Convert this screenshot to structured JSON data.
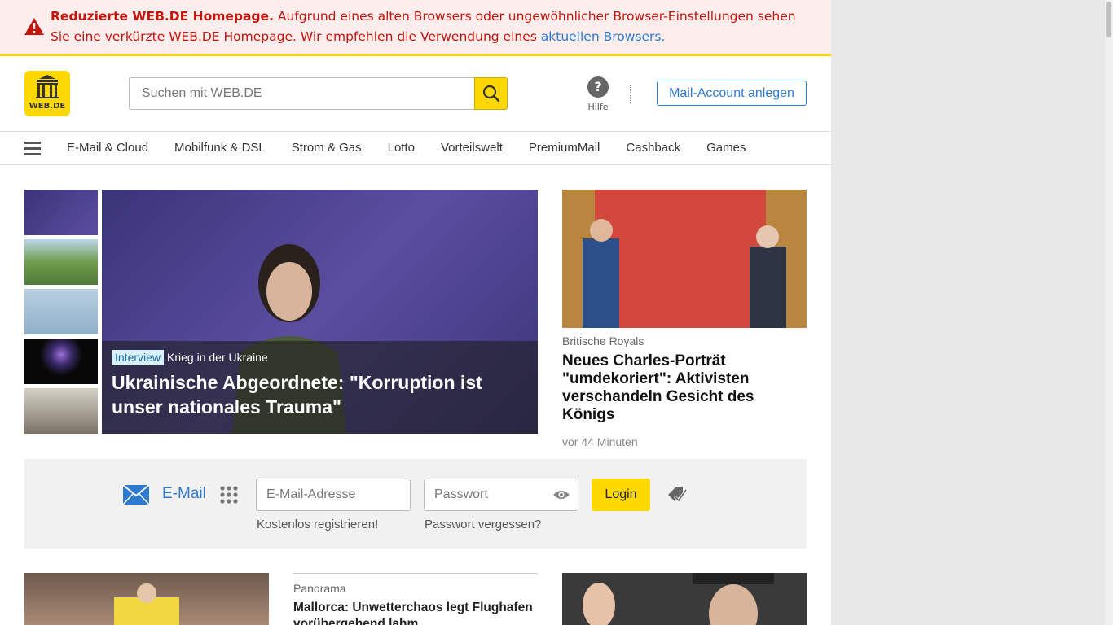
{
  "warning": {
    "bold": "Reduzierte WEB.DE Homepage.",
    "text": " Aufgrund eines alten Browsers oder ungewöhnlicher Browser-Einstellungen sehen Sie eine verkürzte WEB.DE Homepage. Wir empfehlen die Verwendung eines ",
    "link": "aktuellen Browsers."
  },
  "header": {
    "logo_text": "WEB.DE",
    "search_placeholder": "Suchen mit WEB.DE",
    "help_label": "Hilfe",
    "help_glyph": "?",
    "account_button": "Mail-Account anlegen"
  },
  "nav": {
    "items": [
      "E-Mail & Cloud",
      "Mobilfunk & DSL",
      "Strom & Gas",
      "Lotto",
      "Vorteilswelt",
      "PremiumMail",
      "Cashback",
      "Games"
    ]
  },
  "hero": {
    "badge": "Interview",
    "kicker": "Krieg in der Ukraine",
    "title": "Ukrainische Abgeordnete: \"Korruption ist unser nationales Trauma\""
  },
  "side_article": {
    "category": "Britische Royals",
    "title": "Neues Charles-Porträt \"umdekoriert\": Aktivisten verschandeln Gesicht des Königs",
    "time": "vor 44 Minuten"
  },
  "login": {
    "mail_label": "E-Mail",
    "email_placeholder": "E-Mail-Adresse",
    "password_placeholder": "Passwort",
    "login_button": "Login",
    "register_link": "Kostenlos registrieren!",
    "forgot_link": "Passwort vergessen?"
  },
  "bottom_article": {
    "category": "Panorama",
    "title": "Mallorca: Unwetterchaos legt Flughafen vorübergehend lahm"
  },
  "colors": {
    "brand_yellow": "#ffd800",
    "link_blue": "#2e7ad1",
    "warning_red": "#c4150c"
  }
}
